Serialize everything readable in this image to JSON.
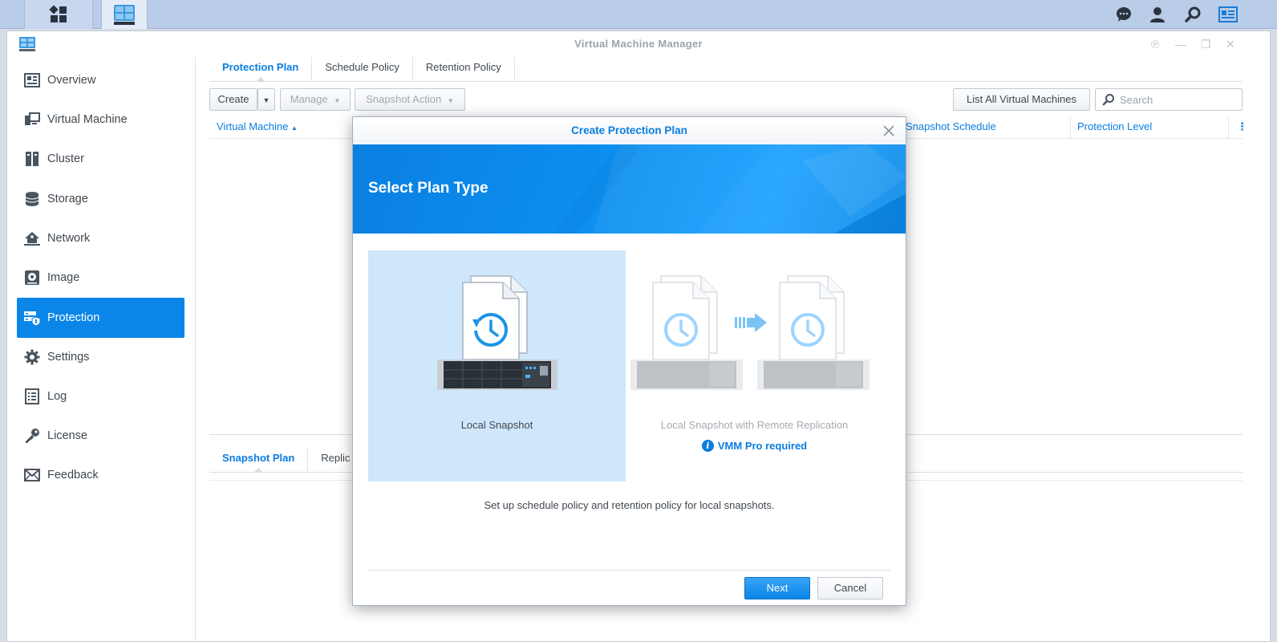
{
  "window": {
    "title": "Virtual Machine Manager"
  },
  "sidebar": {
    "items": [
      {
        "label": "Overview",
        "icon": "overview-icon"
      },
      {
        "label": "Virtual Machine",
        "icon": "virtual-machine-icon"
      },
      {
        "label": "Cluster",
        "icon": "cluster-icon"
      },
      {
        "label": "Storage",
        "icon": "storage-icon"
      },
      {
        "label": "Network",
        "icon": "network-icon"
      },
      {
        "label": "Image",
        "icon": "image-icon"
      },
      {
        "label": "Protection",
        "icon": "protection-icon",
        "active": true
      },
      {
        "label": "Settings",
        "icon": "gear-icon"
      },
      {
        "label": "Log",
        "icon": "log-icon"
      },
      {
        "label": "License",
        "icon": "key-icon"
      },
      {
        "label": "Feedback",
        "icon": "envelope-icon"
      }
    ]
  },
  "main": {
    "tabs": [
      {
        "label": "Protection Plan",
        "active": true
      },
      {
        "label": "Schedule Policy"
      },
      {
        "label": "Retention Policy"
      }
    ],
    "toolbar": {
      "create": "Create",
      "manage": "Manage",
      "snapshot_action": "Snapshot Action",
      "list_all": "List All Virtual Machines",
      "search_placeholder": "Search"
    },
    "columns": {
      "virtual_machine": "Virtual Machine",
      "snapshot_schedule": "Snapshot Schedule",
      "protection_level": "Protection Level"
    },
    "bottom_tabs": [
      {
        "label": "Snapshot Plan",
        "active": true
      },
      {
        "label": "Replic"
      }
    ]
  },
  "modal": {
    "title": "Create Protection Plan",
    "banner_title": "Select Plan Type",
    "options": {
      "local": {
        "label": "Local Snapshot",
        "selected": true
      },
      "remote": {
        "label": "Local Snapshot with Remote Replication",
        "note": "VMM Pro required",
        "disabled": true
      }
    },
    "description": "Set up schedule policy and retention policy for local snapshots.",
    "next": "Next",
    "cancel": "Cancel"
  },
  "colors": {
    "accent": "#0a86e8",
    "selected_option_bg": "#cfe7fb"
  }
}
